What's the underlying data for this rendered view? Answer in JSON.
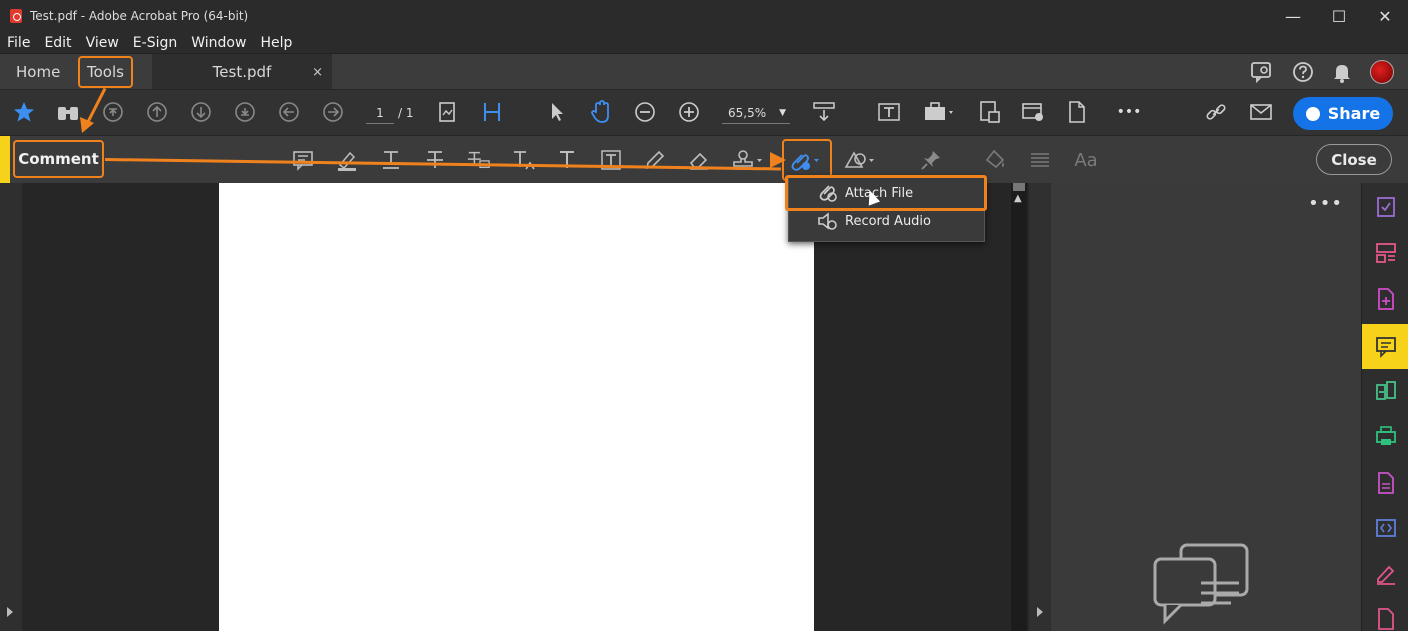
{
  "window": {
    "title": "Test.pdf - Adobe Acrobat Pro (64-bit)",
    "min": "—",
    "max": "☐",
    "close": "✕"
  },
  "menu": [
    "File",
    "Edit",
    "View",
    "E-Sign",
    "Window",
    "Help"
  ],
  "tabs": {
    "home": "Home",
    "tools": "Tools",
    "doc": "Test.pdf",
    "doc_close": "×"
  },
  "toolbar": {
    "page_current": "1",
    "page_total": "/ 1",
    "zoom": "65,5%",
    "share": "Share",
    "more": "•••"
  },
  "comment": {
    "label": "Comment",
    "close": "Close",
    "text_style": "Aa"
  },
  "dropdown": {
    "attach_file": "Attach File",
    "record_audio": "Record Audio"
  },
  "rightpane": {
    "more": "•••"
  },
  "colors": {
    "accent": "#f0821e",
    "share": "#1473e6",
    "comment_active": "#f6d21a"
  }
}
